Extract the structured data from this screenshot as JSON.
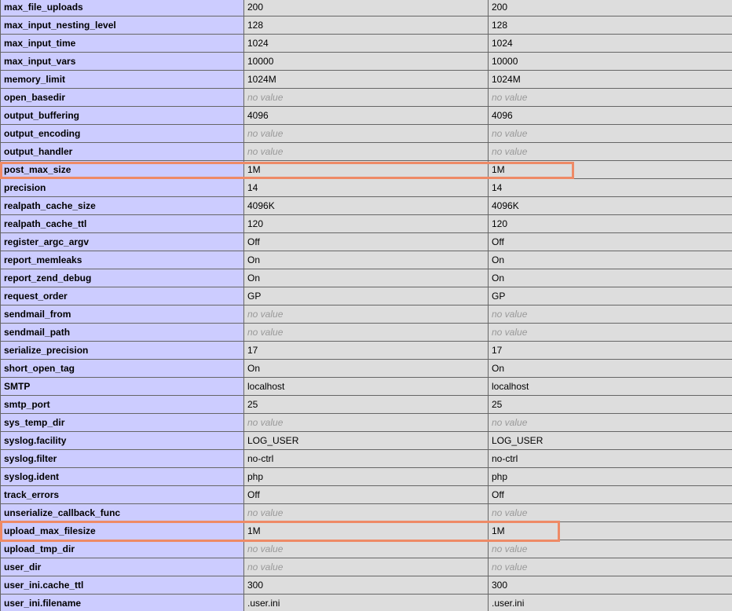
{
  "colors": {
    "directive_bg": "#ccccff",
    "value_bg": "#dddddd",
    "border": "#666666",
    "no_value_text": "#999999",
    "highlight": "#ee8a66"
  },
  "rows": [
    {
      "name": "max_file_uploads",
      "local": "200",
      "master": "200"
    },
    {
      "name": "max_input_nesting_level",
      "local": "128",
      "master": "128"
    },
    {
      "name": "max_input_time",
      "local": "1024",
      "master": "1024"
    },
    {
      "name": "max_input_vars",
      "local": "10000",
      "master": "10000"
    },
    {
      "name": "memory_limit",
      "local": "1024M",
      "master": "1024M"
    },
    {
      "name": "open_basedir",
      "local": "no value",
      "master": "no value"
    },
    {
      "name": "output_buffering",
      "local": "4096",
      "master": "4096"
    },
    {
      "name": "output_encoding",
      "local": "no value",
      "master": "no value"
    },
    {
      "name": "output_handler",
      "local": "no value",
      "master": "no value"
    },
    {
      "name": "post_max_size",
      "local": "1M",
      "master": "1M"
    },
    {
      "name": "precision",
      "local": "14",
      "master": "14"
    },
    {
      "name": "realpath_cache_size",
      "local": "4096K",
      "master": "4096K"
    },
    {
      "name": "realpath_cache_ttl",
      "local": "120",
      "master": "120"
    },
    {
      "name": "register_argc_argv",
      "local": "Off",
      "master": "Off"
    },
    {
      "name": "report_memleaks",
      "local": "On",
      "master": "On"
    },
    {
      "name": "report_zend_debug",
      "local": "On",
      "master": "On"
    },
    {
      "name": "request_order",
      "local": "GP",
      "master": "GP"
    },
    {
      "name": "sendmail_from",
      "local": "no value",
      "master": "no value"
    },
    {
      "name": "sendmail_path",
      "local": "no value",
      "master": "no value"
    },
    {
      "name": "serialize_precision",
      "local": "17",
      "master": "17"
    },
    {
      "name": "short_open_tag",
      "local": "On",
      "master": "On"
    },
    {
      "name": "SMTP",
      "local": "localhost",
      "master": "localhost"
    },
    {
      "name": "smtp_port",
      "local": "25",
      "master": "25"
    },
    {
      "name": "sys_temp_dir",
      "local": "no value",
      "master": "no value"
    },
    {
      "name": "syslog.facility",
      "local": "LOG_USER",
      "master": "LOG_USER"
    },
    {
      "name": "syslog.filter",
      "local": "no-ctrl",
      "master": "no-ctrl"
    },
    {
      "name": "syslog.ident",
      "local": "php",
      "master": "php"
    },
    {
      "name": "track_errors",
      "local": "Off",
      "master": "Off"
    },
    {
      "name": "unserialize_callback_func",
      "local": "no value",
      "master": "no value"
    },
    {
      "name": "upload_max_filesize",
      "local": "1M",
      "master": "1M"
    },
    {
      "name": "upload_tmp_dir",
      "local": "no value",
      "master": "no value"
    },
    {
      "name": "user_dir",
      "local": "no value",
      "master": "no value"
    },
    {
      "name": "user_ini.cache_ttl",
      "local": "300",
      "master": "300"
    },
    {
      "name": "user_ini.filename",
      "local": ".user.ini",
      "master": ".user.ini"
    }
  ],
  "highlighted_rows": [
    "post_max_size",
    "upload_max_filesize"
  ]
}
